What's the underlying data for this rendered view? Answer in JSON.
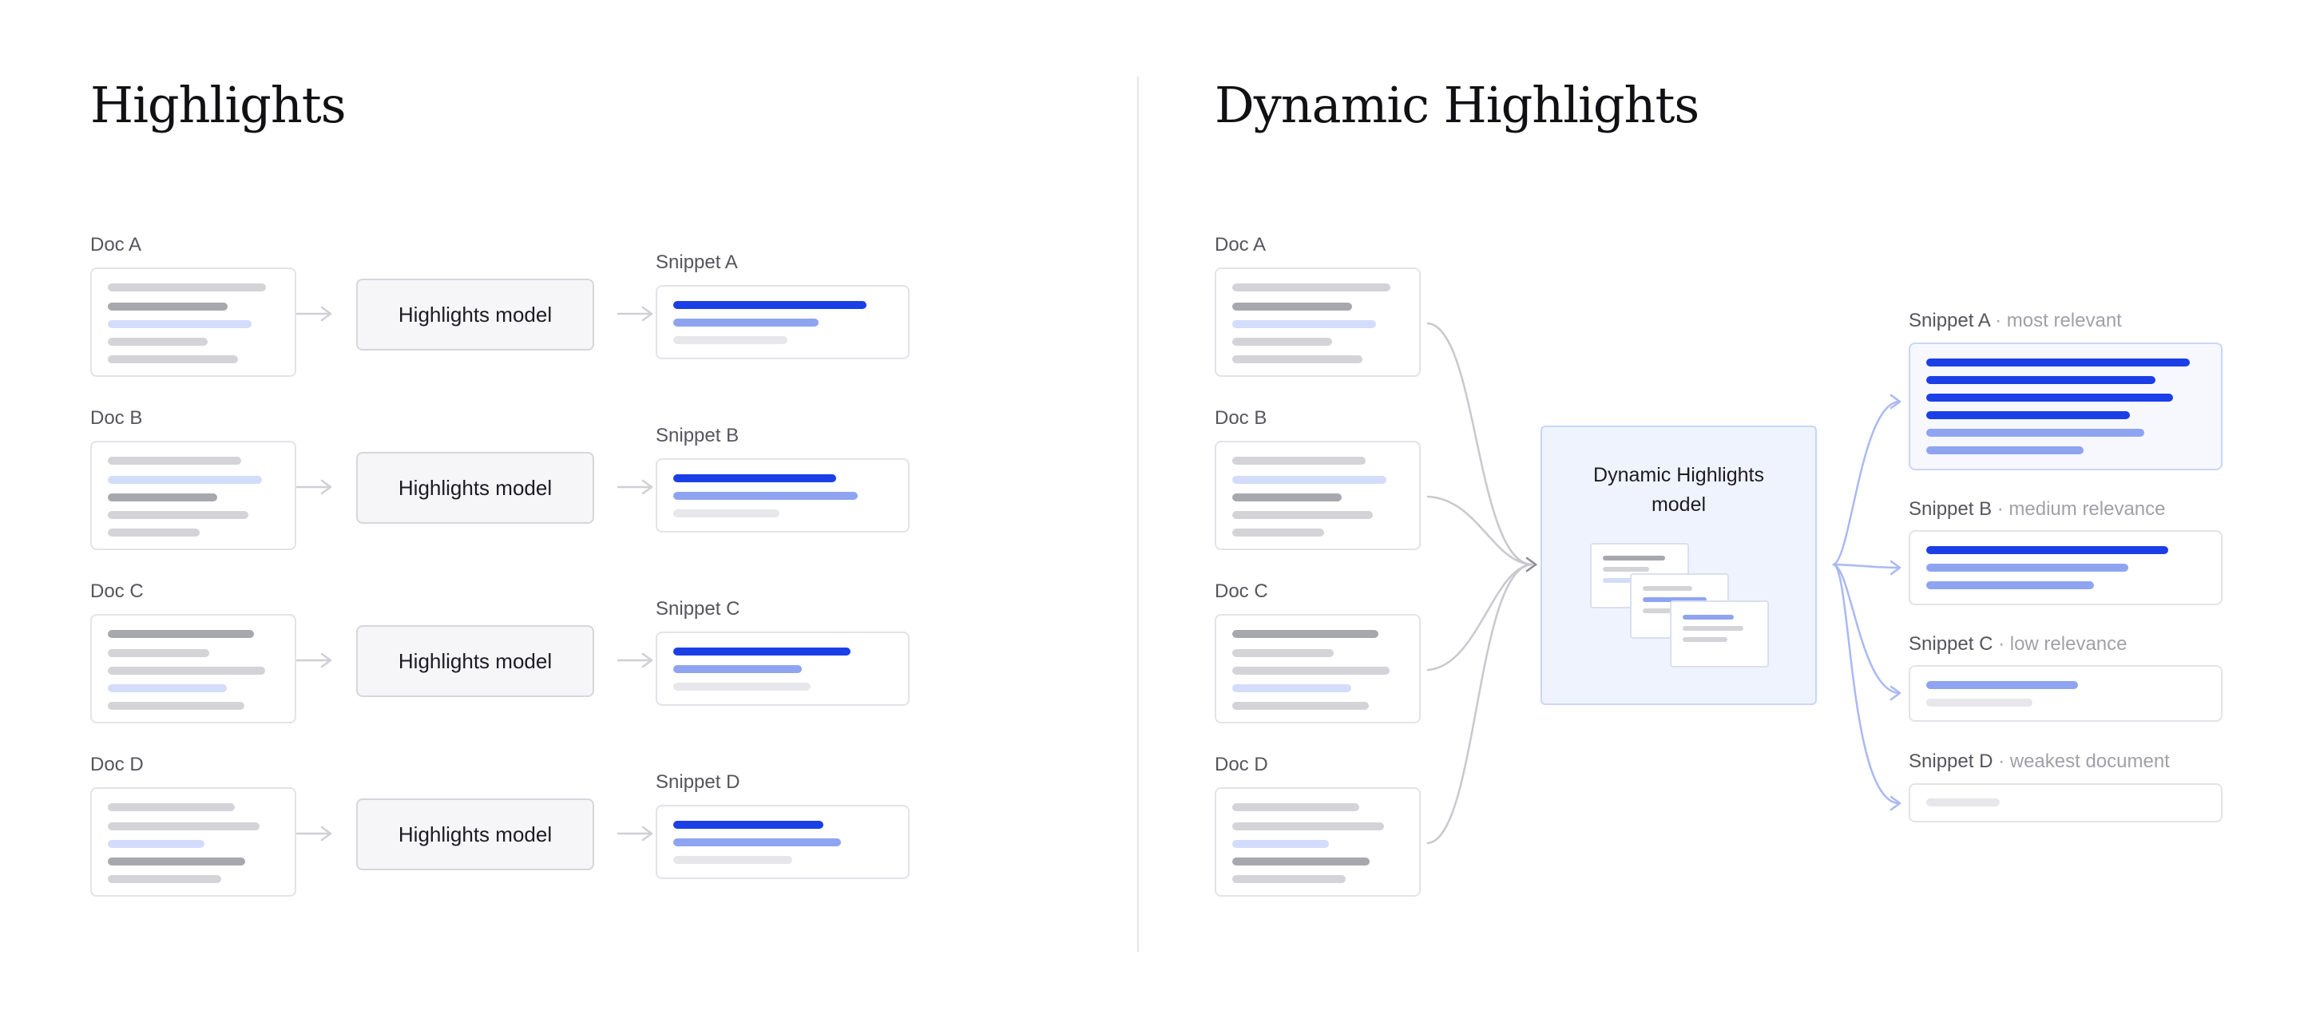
{
  "left_panel": {
    "title": "Highlights",
    "docs": [
      "Doc A",
      "Doc B",
      "Doc C",
      "Doc D"
    ],
    "model_label": "Highlights model",
    "snippets": [
      "Snippet A",
      "Snippet B",
      "Snippet C",
      "Snippet D"
    ]
  },
  "right_panel": {
    "title": "Dynamic Highlights",
    "docs": [
      "Doc A",
      "Doc B",
      "Doc C",
      "Doc D"
    ],
    "model_label_line1": "Dynamic Highlights",
    "model_label_line2": "model",
    "snippets": [
      {
        "name": "Snippet A",
        "note": "· most relevant"
      },
      {
        "name": "Snippet B",
        "note": "· medium relevance"
      },
      {
        "name": "Snippet C",
        "note": "· low relevance"
      },
      {
        "name": "Snippet D",
        "note": "· weakest document"
      }
    ]
  },
  "colors": {
    "accent_blue": "#1b3fe6",
    "mid_blue": "#8fa4f1",
    "light_blue": "#d3dcfa",
    "connector_gray": "#c8c8ce",
    "connector_blue": "#9db0f0"
  }
}
